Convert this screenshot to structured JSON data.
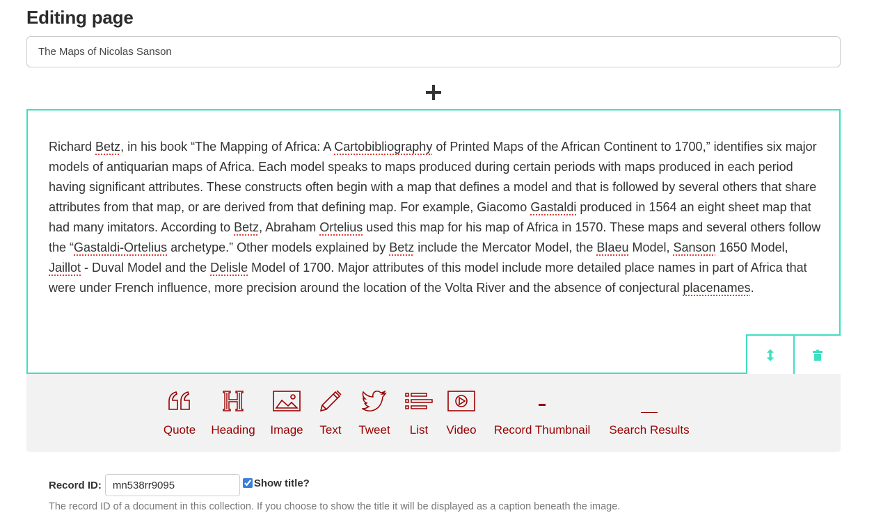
{
  "header": {
    "title": "Editing page"
  },
  "page_title_input": {
    "value": "The Maps of Nicolas Sanson",
    "placeholder": ""
  },
  "add_block": {
    "icon": "plus-icon"
  },
  "text_block": {
    "segments": [
      {
        "t": "Richard "
      },
      {
        "t": "Betz",
        "spell": true
      },
      {
        "t": ", in his book “The Mapping of Africa: A "
      },
      {
        "t": "Cartobibliography",
        "spell": true
      },
      {
        "t": " of Printed Maps of the African Continent to 1700,” identifies six major models of antiquarian maps of Africa. Each model speaks to maps produced during certain periods with maps produced in each period having significant attributes. These constructs often begin with a map that defines a model and that is followed by several others that share attributes from that map, or are derived from that defining map. For example, Giacomo "
      },
      {
        "t": "Gastaldi",
        "spell": true
      },
      {
        "t": " produced in 1564 an eight sheet map that had many imitators. According to "
      },
      {
        "t": "Betz",
        "spell": true
      },
      {
        "t": ", Abraham "
      },
      {
        "t": "Ortelius",
        "spell": true
      },
      {
        "t": " used this map for his map of Africa in 1570. These maps and several others follow the “"
      },
      {
        "t": "Gastaldi-Ortelius",
        "spell": true
      },
      {
        "t": " archetype.” Other models explained by "
      },
      {
        "t": "Betz",
        "spell": true
      },
      {
        "t": " include the Mercator Model, the "
      },
      {
        "t": "Blaeu",
        "spell": true
      },
      {
        "t": " Model, "
      },
      {
        "t": "Sanson",
        "spell": true
      },
      {
        "t": " 1650 Model, "
      },
      {
        "t": "Jaillot",
        "spell": true
      },
      {
        "t": " - Duval Model and the "
      },
      {
        "t": "Delisle",
        "spell": true
      },
      {
        "t": " Model of 1700. Major attributes of this model include more detailed place names in part of Africa that were under French influence, more precision around the location of the Volta River and the absence of conjectural "
      },
      {
        "t": "placenames",
        "spell": true
      },
      {
        "t": "."
      }
    ],
    "actions": [
      {
        "name": "move",
        "icon": "reorder-arrows-icon"
      },
      {
        "name": "delete",
        "icon": "trash-icon"
      }
    ],
    "accent_color": "#3fdfc0"
  },
  "toolbar": {
    "color": "#990000",
    "items": [
      {
        "label": "Quote",
        "icon": "quote-icon"
      },
      {
        "label": "Heading",
        "icon": "heading-icon"
      },
      {
        "label": "Image",
        "icon": "image-icon"
      },
      {
        "label": "Text",
        "icon": "pencil-icon"
      },
      {
        "label": "Tweet",
        "icon": "twitter-bird-icon"
      },
      {
        "label": "List",
        "icon": "list-icon"
      },
      {
        "label": "Video",
        "icon": "video-play-icon"
      },
      {
        "label": "Record Thumbnail",
        "icon": "record-thumbnail-icon"
      },
      {
        "label": "Search Results",
        "icon": "search-results-icon"
      }
    ]
  },
  "record": {
    "label": "Record ID:",
    "value": "mn538rr9095",
    "show_title_label": "Show title?",
    "show_title_checked": true,
    "help": "The record ID of a document in this collection. If you choose to show the title it will be displayed as a caption beneath the image."
  }
}
